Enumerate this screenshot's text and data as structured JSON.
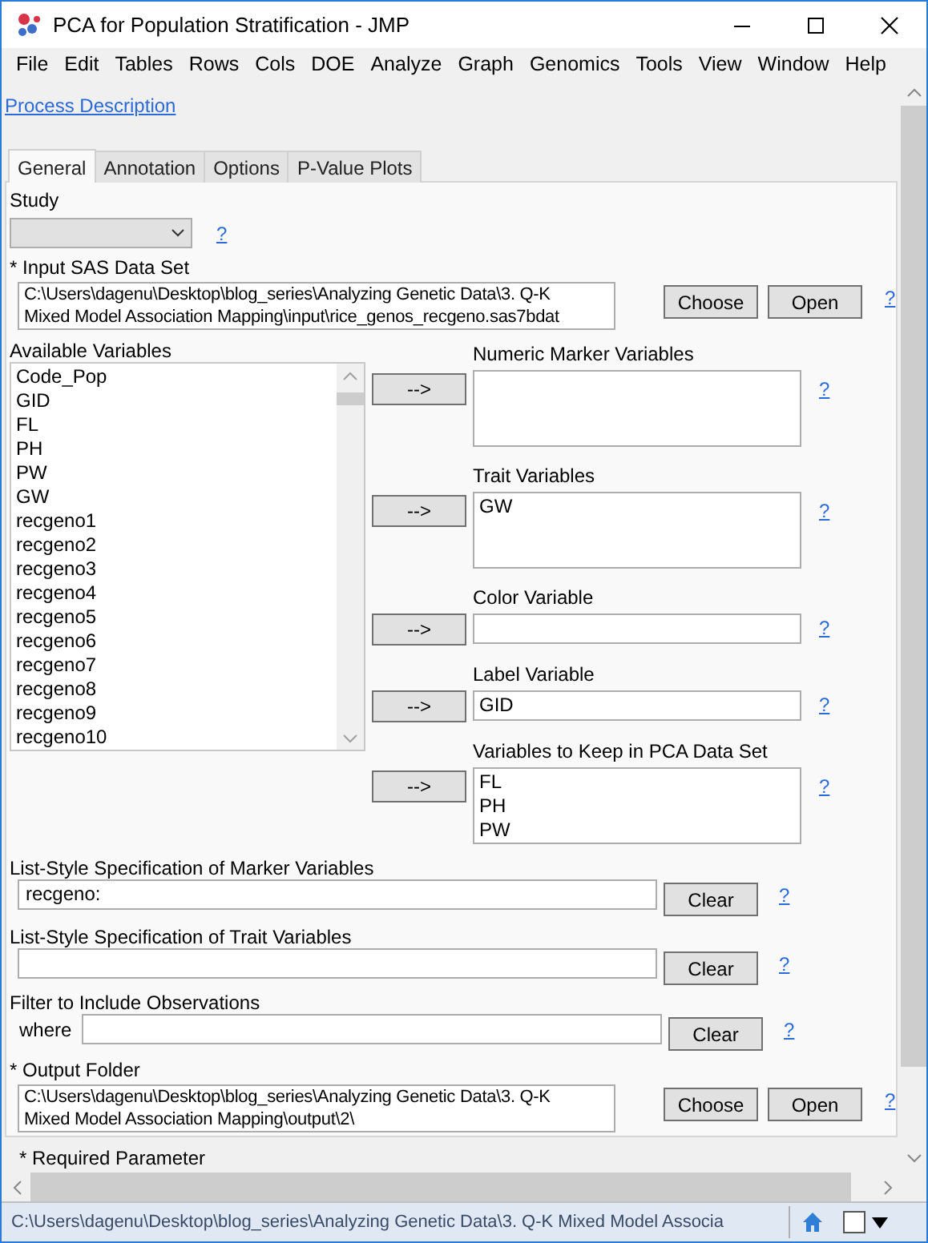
{
  "window": {
    "title": "PCA for Population Stratification - JMP"
  },
  "menu": [
    "File",
    "Edit",
    "Tables",
    "Rows",
    "Cols",
    "DOE",
    "Analyze",
    "Graph",
    "Genomics",
    "Tools",
    "View",
    "Window",
    "Help"
  ],
  "process_link": "Process Description",
  "tabs": [
    {
      "label": "General",
      "selected": true
    },
    {
      "label": "Annotation",
      "selected": false
    },
    {
      "label": "Options",
      "selected": false
    },
    {
      "label": "P-Value Plots",
      "selected": false
    }
  ],
  "study": {
    "label": "Study",
    "help": "?"
  },
  "input_data_set": {
    "label": "* Input SAS Data Set",
    "lines": [
      "C:\\Users\\dagenu\\Desktop\\blog_series\\Analyzing Genetic Data\\3. Q-K",
      "Mixed Model Association Mapping\\input\\rice_genos_recgeno.sas7bdat"
    ],
    "buttons": [
      "Choose",
      "Open"
    ],
    "help": "?"
  },
  "available_variables": {
    "label": "Available Variables",
    "items": [
      "Code_Pop",
      "GID",
      "FL",
      "PH",
      "PW",
      "GW",
      "recgeno1",
      "recgeno2",
      "recgeno3",
      "recgeno4",
      "recgeno5",
      "recgeno6",
      "recgeno7",
      "recgeno8",
      "recgeno9",
      "recgeno10"
    ]
  },
  "targets": [
    {
      "label": "Numeric Marker Variables",
      "kind": "list",
      "button": "-->",
      "help": "?"
    },
    {
      "label": "Trait Variables",
      "kind": "list",
      "button": "-->",
      "items": [
        "GW"
      ],
      "help": "?"
    },
    {
      "label": "Color Variable",
      "kind": "field",
      "button": "-->",
      "help": "?"
    },
    {
      "label": "Label Variable",
      "kind": "field",
      "button": "-->",
      "value": "GID",
      "help": "?"
    },
    {
      "label": "Variables to Keep in PCA Data Set",
      "kind": "list",
      "button": "-->",
      "items": [
        "FL",
        "PH",
        "PW"
      ],
      "help": "?"
    }
  ],
  "list_specs": [
    {
      "label": "List-Style Specification of Marker Variables",
      "value": "recgeno:",
      "button": "Clear",
      "help": "?"
    },
    {
      "label": "List-Style Specification of Trait Variables",
      "button": "Clear",
      "help": "?"
    }
  ],
  "filter": {
    "label": "Filter to Include Observations",
    "prefix": "where",
    "button": "Clear",
    "help": "?"
  },
  "output_folder": {
    "label": "* Output Folder",
    "lines": [
      "C:\\Users\\dagenu\\Desktop\\blog_series\\Analyzing Genetic Data\\3. Q-K",
      "Mixed Model Association Mapping\\output\\2\\"
    ],
    "buttons": [
      "Choose",
      "Open"
    ],
    "help": "?"
  },
  "required_note": "* Required Parameter",
  "status_bar": {
    "path": "C:\\Users\\dagenu\\Desktop\\blog_series\\Analyzing Genetic Data\\3. Q-K Mixed Model Associa"
  }
}
